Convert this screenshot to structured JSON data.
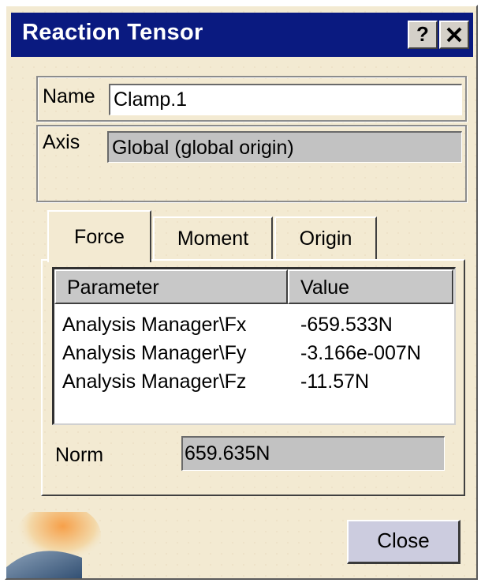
{
  "window": {
    "title": "Reaction Tensor",
    "help_label": "?"
  },
  "name_field": {
    "label": "Name",
    "value": "Clamp.1"
  },
  "axis_field": {
    "label": "Axis",
    "value": "Global (global origin)"
  },
  "tabs": [
    {
      "label": "Force",
      "selected": true
    },
    {
      "label": "Moment",
      "selected": false
    },
    {
      "label": "Origin",
      "selected": false
    }
  ],
  "table": {
    "headers": [
      "Parameter",
      "Value"
    ],
    "rows": [
      {
        "parameter": "Analysis Manager\\Fx",
        "value": "-659.533N"
      },
      {
        "parameter": "Analysis Manager\\Fy",
        "value": "-3.166e-007N"
      },
      {
        "parameter": "Analysis Manager\\Fz",
        "value": "-11.57N"
      }
    ]
  },
  "norm": {
    "label": "Norm",
    "value": "659.635N"
  },
  "buttons": {
    "close_label": "Close"
  },
  "colors": {
    "titlebar": "#0a1a80",
    "dialog_background": "#f3ead2",
    "readonly_field": "#c2c2c2"
  }
}
